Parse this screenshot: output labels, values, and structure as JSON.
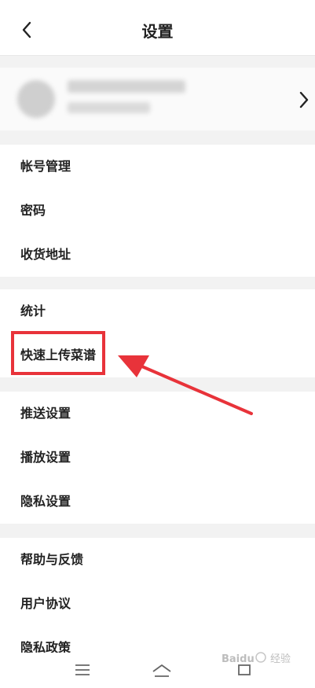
{
  "header": {
    "title": "设置"
  },
  "settings": {
    "group1": [
      "帐号管理",
      "密码",
      "收货地址"
    ],
    "group2": [
      "统计",
      "快速上传菜谱"
    ],
    "group3": [
      "推送设置",
      "播放设置",
      "隐私设置"
    ],
    "group4": [
      "帮助与反馈",
      "用户协议",
      "隐私政策"
    ]
  },
  "colors": {
    "highlight": "#e8333a",
    "background": "#f2f2f2"
  },
  "watermark": {
    "brand": "Baidu",
    "sub": "经验"
  }
}
